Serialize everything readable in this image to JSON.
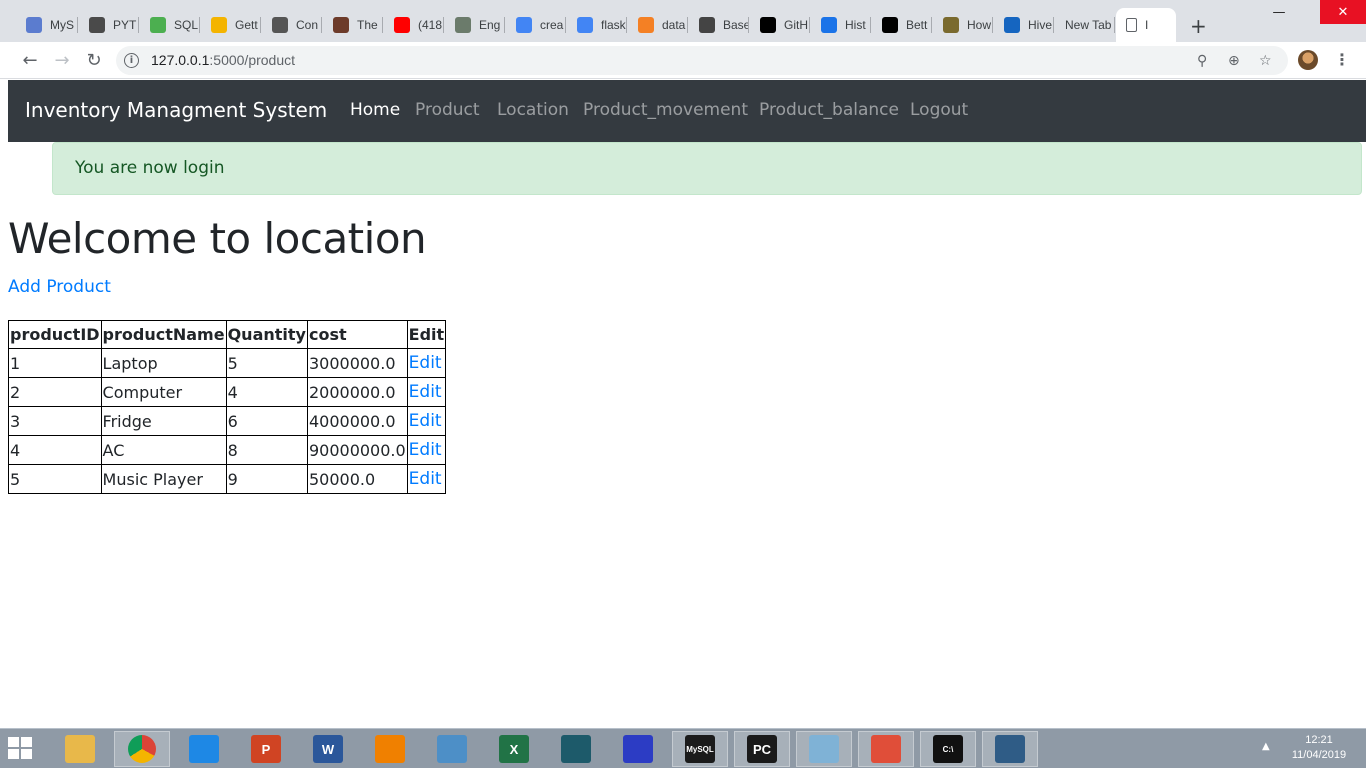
{
  "browser": {
    "tabs": [
      {
        "label": "MyS",
        "icon": "mysql-letter-icon",
        "color": "#5b7ccf"
      },
      {
        "label": "PYT",
        "icon": "slides-icon",
        "color": "#4a4a4a"
      },
      {
        "label": "SQL",
        "icon": "sql-chart-icon",
        "color": "#4caf50"
      },
      {
        "label": "Gett",
        "icon": "google-cloud-icon",
        "color": "#f4b400"
      },
      {
        "label": "Con",
        "icon": "phone-icon",
        "color": "#555555"
      },
      {
        "label": "The",
        "icon": "photo-icon",
        "color": "#6d3b2a"
      },
      {
        "label": "(418",
        "icon": "youtube-icon",
        "color": "#ff0000"
      },
      {
        "label": "Eng",
        "icon": "circle-logo-icon",
        "color": "#6b7b6b"
      },
      {
        "label": "crea",
        "icon": "google-icon",
        "color": "#4285f4"
      },
      {
        "label": "flask",
        "icon": "google-icon",
        "color": "#4285f4"
      },
      {
        "label": "data",
        "icon": "stackoverflow-icon",
        "color": "#f48024"
      },
      {
        "label": "Base",
        "icon": "docs-icon",
        "color": "#444444"
      },
      {
        "label": "GitH",
        "icon": "github-icon",
        "color": "#000000"
      },
      {
        "label": "Hist",
        "icon": "history-icon",
        "color": "#1a73e8"
      },
      {
        "label": "Bett",
        "icon": "medium-icon",
        "color": "#000000"
      },
      {
        "label": "How",
        "icon": "hackerrank-icon",
        "color": "#7a6a2e"
      },
      {
        "label": "Hive",
        "icon": "bars-icon",
        "color": "#1565c0"
      },
      {
        "label": "New Tab",
        "icon": "",
        "color": ""
      },
      {
        "label": "I",
        "icon": "page-icon",
        "color": "#5f6368",
        "active": true
      }
    ],
    "url_host": "127.0.0.1",
    "url_path": ":5000/product"
  },
  "navbar": {
    "brand": "Inventory Managment System",
    "links": [
      "Home",
      "Product",
      "Location",
      "Product_movement",
      "Product_balance",
      "Logout"
    ],
    "active_index": 0
  },
  "alert": {
    "message": "You are now login"
  },
  "page": {
    "title": "Welcome to location",
    "add_link": "Add Product"
  },
  "table": {
    "headers": [
      "productID",
      "productName",
      "Quantity",
      "cost",
      "Edit"
    ],
    "rows": [
      [
        "1",
        "Laptop",
        "5",
        "3000000.0",
        "Edit"
      ],
      [
        "2",
        "Computer",
        "4",
        "2000000.0",
        "Edit"
      ],
      [
        "3",
        "Fridge",
        "6",
        "4000000.0",
        "Edit"
      ],
      [
        "4",
        "AC",
        "8",
        "90000000.0",
        "Edit"
      ],
      [
        "5",
        "Music Player",
        "9",
        "50000.0",
        "Edit"
      ]
    ]
  },
  "taskbar": {
    "apps": [
      {
        "name": "file-explorer-icon",
        "color": "#e8b84a"
      },
      {
        "name": "chrome-icon",
        "color": "#db4437",
        "running": true
      },
      {
        "name": "internet-explorer-icon",
        "color": "#1e88e5"
      },
      {
        "name": "powerpoint-icon",
        "color": "#d04423",
        "glyph": "P"
      },
      {
        "name": "word-icon",
        "color": "#2b579a",
        "glyph": "W"
      },
      {
        "name": "vlc-icon",
        "color": "#f08000"
      },
      {
        "name": "network-tool-icon",
        "color": "#4d8fc7"
      },
      {
        "name": "excel-icon",
        "color": "#217346",
        "glyph": "X"
      },
      {
        "name": "book-icon",
        "color": "#1d5a6a"
      },
      {
        "name": "audacity-icon",
        "color": "#2c3cc4"
      },
      {
        "name": "mysql-console-icon",
        "color": "#1b1b1b",
        "glyph": "MySQL",
        "running": true
      },
      {
        "name": "pycharm-icon",
        "color": "#1a1a1a",
        "glyph": "PC",
        "running": true
      },
      {
        "name": "notepad-icon",
        "color": "#7fb2d6",
        "running": true
      },
      {
        "name": "git-icon",
        "color": "#e04e39",
        "running": true
      },
      {
        "name": "cmd-icon",
        "color": "#111111",
        "glyph": "C:\\",
        "running": true
      },
      {
        "name": "mysql-workbench-icon",
        "color": "#2f5c86",
        "running": true
      }
    ],
    "time": "12:21",
    "date": "11/04/2019"
  }
}
